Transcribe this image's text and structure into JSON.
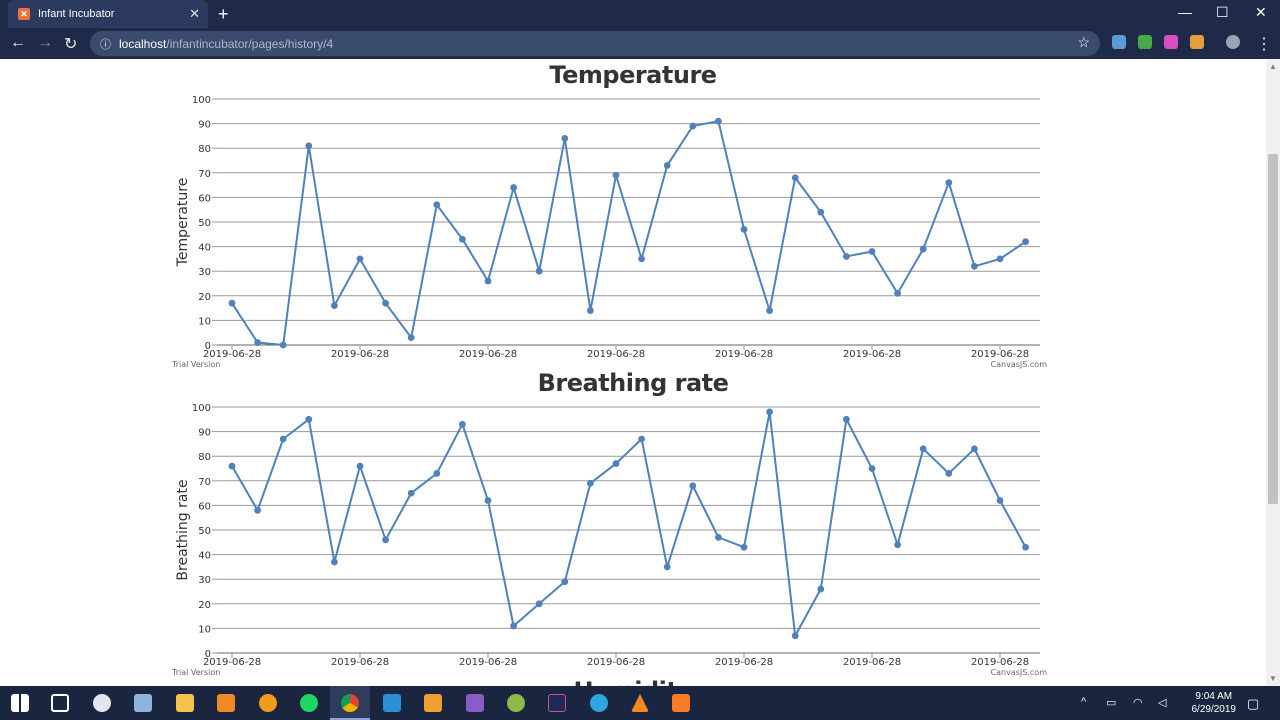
{
  "browser": {
    "tab_title": "Infant Incubator",
    "url_host": "localhost",
    "url_path": "/infantincubator/pages/history/4",
    "new_tab": "+",
    "close_tab": "✕"
  },
  "charts_meta": {
    "watermark_left": "Trial Version",
    "watermark_right": "CanvasJS.com"
  },
  "partial_next_title": "Humidity",
  "taskbar": {
    "time": "9:04 AM",
    "date": "6/29/2019"
  },
  "colors": {
    "line": "#4f81bc",
    "titlebar": "#1e2a47",
    "taskbar": "#1a2540"
  },
  "chart_data": [
    {
      "type": "line",
      "title": "Temperature",
      "ylabel": "Temperature",
      "xlabel": "",
      "ylim": [
        0,
        100
      ],
      "yticks": [
        0,
        10,
        20,
        30,
        40,
        50,
        60,
        70,
        80,
        90,
        100
      ],
      "xtick_labels": [
        "2019-06-28",
        "2019-06-28",
        "2019-06-28",
        "2019-06-28",
        "2019-06-28",
        "2019-06-28",
        "2019-06-28"
      ],
      "grid": true,
      "series": [
        {
          "values": [
            17,
            1,
            0,
            81,
            16,
            35,
            17,
            3,
            57,
            43,
            26,
            64,
            30,
            84,
            14,
            69,
            35,
            73,
            89,
            91,
            47,
            14,
            68,
            54,
            36,
            38,
            21,
            39,
            66,
            32,
            35,
            42
          ]
        }
      ]
    },
    {
      "type": "line",
      "title": "Breathing rate",
      "ylabel": "Breathing rate",
      "xlabel": "",
      "ylim": [
        0,
        100
      ],
      "yticks": [
        0,
        10,
        20,
        30,
        40,
        50,
        60,
        70,
        80,
        90,
        100
      ],
      "xtick_labels": [
        "2019-06-28",
        "2019-06-28",
        "2019-06-28",
        "2019-06-28",
        "2019-06-28",
        "2019-06-28",
        "2019-06-28"
      ],
      "grid": true,
      "series": [
        {
          "values": [
            76,
            58,
            87,
            95,
            37,
            76,
            46,
            65,
            73,
            93,
            62,
            11,
            20,
            29,
            69,
            77,
            87,
            35,
            68,
            47,
            43,
            98,
            7,
            26,
            95,
            75,
            44,
            83,
            73,
            83,
            62,
            43
          ]
        }
      ]
    }
  ]
}
